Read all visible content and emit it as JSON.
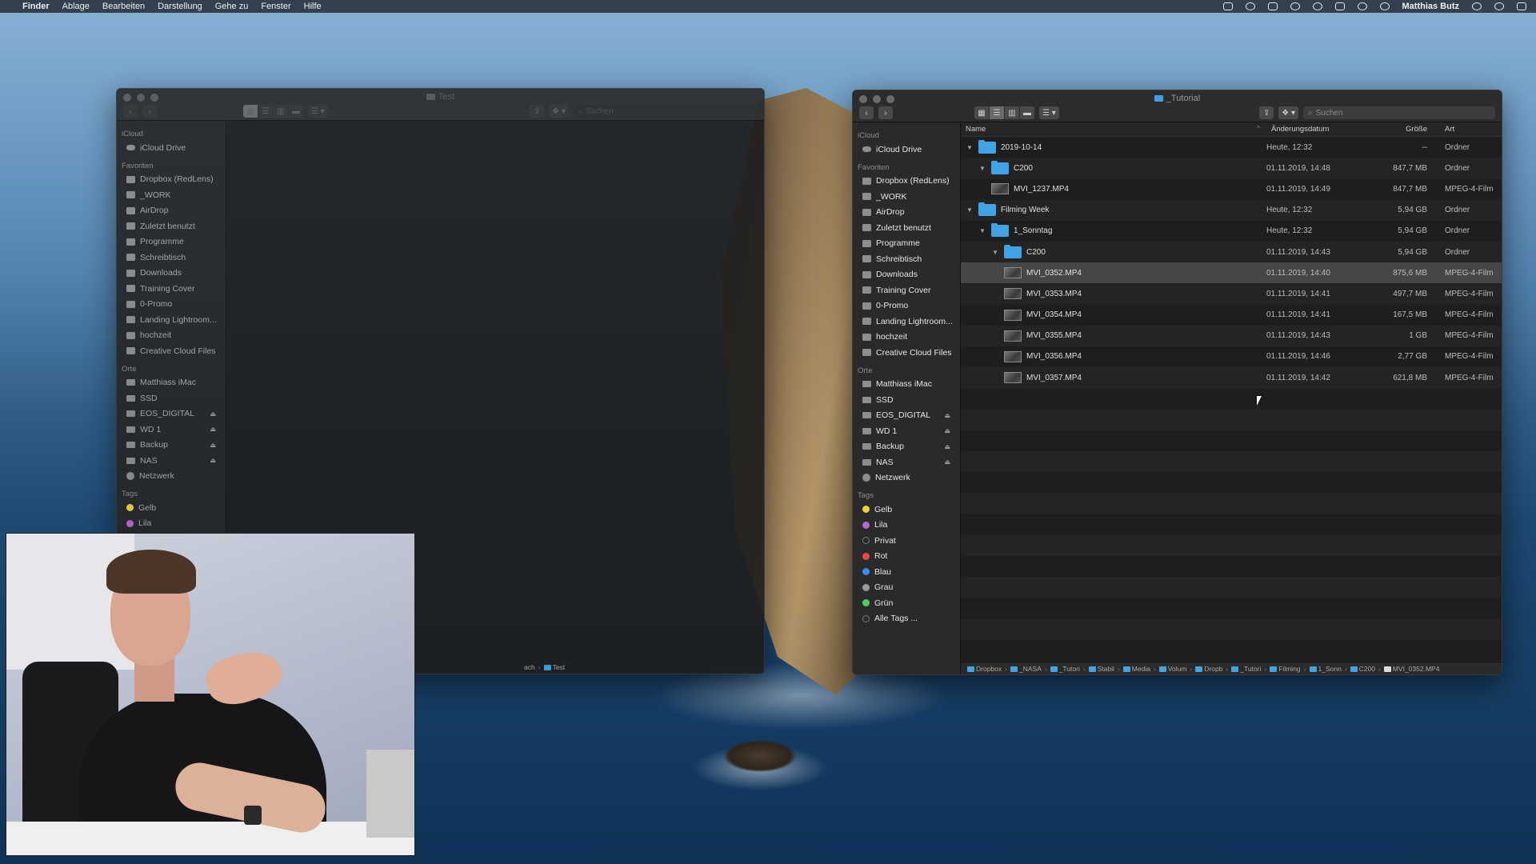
{
  "menubar": {
    "apple": "",
    "app": "Finder",
    "menus": [
      "Ablage",
      "Bearbeiten",
      "Darstellung",
      "Gehe zu",
      "Fenster",
      "Hilfe"
    ],
    "user": "Matthias Butz"
  },
  "left_window": {
    "title": "Test",
    "search_placeholder": "Suchen",
    "path": [
      "ach",
      "Test"
    ],
    "sidebar": {
      "icloud_label": "iCloud",
      "icloud_items": [
        "iCloud Drive"
      ],
      "favorites_label": "Favoriten",
      "favorites": [
        "Dropbox (RedLens)",
        "_WORK",
        "AirDrop",
        "Zuletzt benutzt",
        "Programme",
        "Schreibtisch",
        "Downloads",
        "Training Cover",
        "0-Promo",
        "Landing Lightroom...",
        "hochzeit",
        "Creative Cloud Files"
      ],
      "locations_label": "Orte",
      "locations": [
        "Matthiass iMac",
        "SSD",
        "EOS_DIGITAL",
        "WD 1",
        "Backup",
        "NAS",
        "Netzwerk"
      ],
      "tags_label": "Tags",
      "tags": [
        "Gelb",
        "Lila"
      ]
    }
  },
  "right_window": {
    "title": "_Tutorial",
    "search_placeholder": "Suchen",
    "columns": {
      "name": "Name",
      "date": "Änderungsdatum",
      "size": "Größe",
      "kind": "Art"
    },
    "sidebar": {
      "icloud_label": "iCloud",
      "icloud_items": [
        "iCloud Drive"
      ],
      "favorites_label": "Favoriten",
      "favorites": [
        "Dropbox (RedLens)",
        "_WORK",
        "AirDrop",
        "Zuletzt benutzt",
        "Programme",
        "Schreibtisch",
        "Downloads",
        "Training Cover",
        "0-Promo",
        "Landing Lightroom...",
        "hochzeit",
        "Creative Cloud Files"
      ],
      "locations_label": "Orte",
      "locations": [
        "Matthiass iMac",
        "SSD",
        "EOS_DIGITAL",
        "WD 1",
        "Backup",
        "NAS",
        "Netzwerk"
      ],
      "tags_label": "Tags",
      "tags": [
        "Gelb",
        "Lila",
        "Privat",
        "Rot",
        "Blau",
        "Grau",
        "Grün",
        "Alle Tags ..."
      ]
    },
    "files": [
      {
        "name": "2019-10-14",
        "date": "Heute, 12:32",
        "size": "--",
        "kind": "Ordner"
      },
      {
        "name": "C200",
        "date": "01.11.2019, 14:48",
        "size": "847,7 MB",
        "kind": "Ordner"
      },
      {
        "name": "MVI_1237.MP4",
        "date": "01.11.2019, 14:49",
        "size": "847,7 MB",
        "kind": "MPEG-4-Film"
      },
      {
        "name": "Filming Week",
        "date": "Heute, 12:32",
        "size": "5,94 GB",
        "kind": "Ordner"
      },
      {
        "name": "1_Sonntag",
        "date": "Heute, 12:32",
        "size": "5,94 GB",
        "kind": "Ordner"
      },
      {
        "name": "C200",
        "date": "01.11.2019, 14:43",
        "size": "5,94 GB",
        "kind": "Ordner"
      },
      {
        "name": "MVI_0352.MP4",
        "date": "01.11.2019, 14:40",
        "size": "875,6 MB",
        "kind": "MPEG-4-Film"
      },
      {
        "name": "MVI_0353.MP4",
        "date": "01.11.2019, 14:41",
        "size": "497,7 MB",
        "kind": "MPEG-4-Film"
      },
      {
        "name": "MVI_0354.MP4",
        "date": "01.11.2019, 14:41",
        "size": "167,5 MB",
        "kind": "MPEG-4-Film"
      },
      {
        "name": "MVI_0355.MP4",
        "date": "01.11.2019, 14:43",
        "size": "1 GB",
        "kind": "MPEG-4-Film"
      },
      {
        "name": "MVI_0356.MP4",
        "date": "01.11.2019, 14:46",
        "size": "2,77 GB",
        "kind": "MPEG-4-Film"
      },
      {
        "name": "MVI_0357.MP4",
        "date": "01.11.2019, 14:42",
        "size": "621,8 MB",
        "kind": "MPEG-4-Film"
      }
    ],
    "path": [
      "Dropbox",
      "_NASA",
      "_Tutori",
      "Stabil",
      "Media",
      "Volum",
      "Dropb",
      "_Tutori",
      "Filming",
      "1_Sonn",
      "C200",
      "MVI_0352.MP4"
    ]
  },
  "colors": {
    "folder": "#3fa3e4",
    "tag_gelb": "#f5d233",
    "tag_lila": "#b865d6",
    "tag_rot": "#f0464a",
    "tag_blau": "#3b8cf0",
    "tag_grau": "#9a9a9a",
    "tag_gruen": "#4cd05a"
  }
}
